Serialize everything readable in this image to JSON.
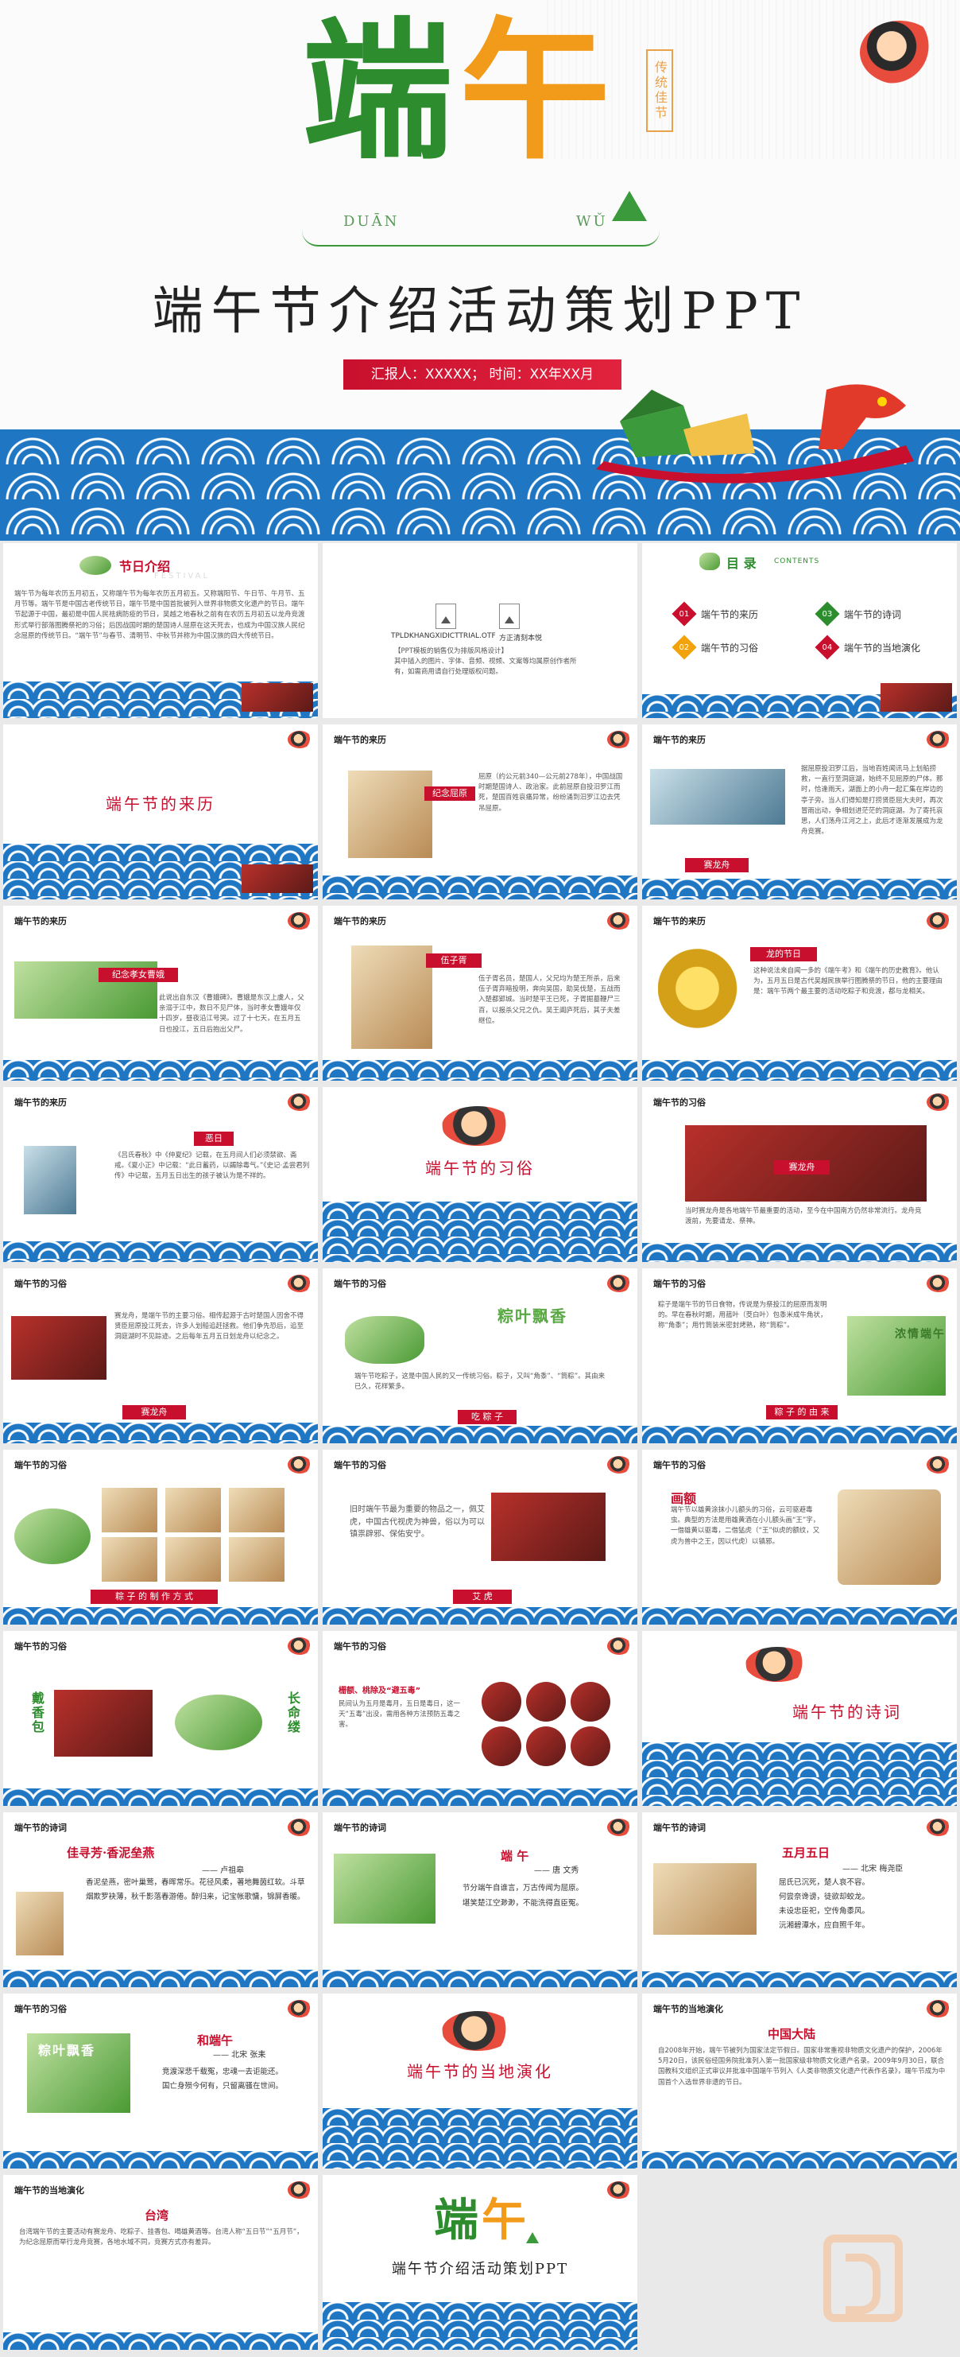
{
  "hero": {
    "title_a": "端",
    "title_b": "午",
    "pinyin_left": "DUĀN",
    "pinyin_right": "WǓ",
    "seal": "传统佳节",
    "subtitle": "端午节介绍活动策划PPT",
    "info": "汇报人：XXXXX； 时间：XX年XX月"
  },
  "slides": {
    "s1": {
      "title": "节日介绍",
      "ghost": "FESTIVAL",
      "body": "端午节为每年农历五月初五，又称端午节为每年农历五月初五。又称端阳节、午日节、午月节、五月节等。端午节是中国古老传统节日，端午节是中国首批被列入世界非物质文化遗产的节日。端午节起源于中国，最初是中国人民祛病防疫的节日，吴越之地春秋之前有在农历五月初五以龙舟竞渡形式举行部落图腾祭祀的习俗；后因战国时期的楚国诗人屈原在这天死去，也成为中国汉族人民纪念屈原的传统节日。“端午节”与春节、清明节、中秋节并称为中国汉族的四大传统节日。"
    },
    "s2": {
      "label1": "TPLDKHANGXIDICTTRIAL.OTF",
      "label2": "方正清刻本悦",
      "body": "【PPT模板的销售仅为排版风格设计】\n其中插入的图片、字体、音频、视频、文案等均属原创作者所有，如需商用请自行处理版权问题。"
    },
    "s3": {
      "title": "目 录",
      "sub": "CONTENTS",
      "items": [
        {
          "num": "01",
          "text": "端午节的来历",
          "color": "#c8102e"
        },
        {
          "num": "02",
          "text": "端午节的习俗",
          "color": "#f2a20b"
        },
        {
          "num": "03",
          "text": "端午节的诗词",
          "color": "#2d8c2d"
        },
        {
          "num": "04",
          "text": "端午节的当地演化",
          "color": "#c8102e"
        }
      ]
    },
    "s4": {
      "title": "端午节的来历"
    },
    "s5": {
      "head": "端午节的来历",
      "bar": "纪念屈原",
      "body": "屈原（约公元前340—公元前278年），中国战国时期楚国诗人、政治家。此前屈原自投汨罗江而死，楚国百姓哀痛异常，纷纷涌到汨罗江边去凭吊屈原。"
    },
    "s6": {
      "head": "端午节的来历",
      "bar": "赛龙舟",
      "body": "据屈原投汨罗江后，当地百姓闻讯马上划船捞救，一直行至洞庭湖，始终不见屈原的尸体。那时，恰逢雨天，湖面上的小舟一起汇集在岸边的亭子旁。当人们得知是打捞贤臣屈大夫时，再次冒雨出动，争相划进茫茫的洞庭湖。为了寄托哀思，人们荡舟江河之上，此后才逐渐发展成为龙舟竞赛。"
    },
    "s7": {
      "head": "端午节的来历",
      "bar": "纪念孝女曹娥",
      "body": "此说出自东汉《曹娥碑》。曹娥是东汉上虞人，父亲溺于江中，数日不见尸体，当时孝女曹娥年仅十四岁，昼夜沿江号哭。过了十七天，在五月五日也投江，五日后抱出父尸。"
    },
    "s8": {
      "head": "端午节的来历",
      "bar": "伍子胥",
      "body": "伍子胥名员，楚国人，父兄均为楚王所杀，后来伍子胥弃暗投明，奔向吴国，助吴伐楚，五战而入楚都郢城。当时楚平王已死，子胥掘墓鞭尸三百，以报杀父兄之仇。吴王阖庐死后，其子夫差继位。"
    },
    "s9": {
      "head": "端午节的来历",
      "bar": "龙的节日",
      "body": "这种说法来自闻一多的《端午考》和《端午的历史教育》。他认为，五月五日是古代吴越民族举行图腾祭的节日，他的主要理由是：端午节两个最主要的活动吃粽子和竞渡，都与龙相关。"
    },
    "s10": {
      "head": "端午节的来历",
      "bar": "恶日",
      "body": "《吕氏春秋》中《仲夏纪》记载，在五月间人们必须禁欲、斋戒。《夏小正》中记载：“此日蓄药，以蠲除毒气。”《史记·孟尝君列传》中记载，五月五日出生的孩子被认为是不祥的。"
    },
    "s11": {
      "title": "端午节的习俗"
    },
    "s12": {
      "head": "端午节的习俗",
      "bar": "赛龙舟",
      "body": "当时赛龙舟是各地端午节最重要的活动，至今在中国南方仍然非常流行。龙舟竞渡前，先要请龙、祭神。"
    },
    "s13": {
      "head": "端午节的习俗",
      "bar": "赛龙舟",
      "body": "赛龙舟，是端午节的主要习俗。相传起源于古时楚国人因舍不得贤臣屈原投江死去，许多人划船追赶拯救。他们争先恐后，追至洞庭湖时不见踪迹。之后每年五月五日划龙舟以纪念之。"
    },
    "s14": {
      "head": "端午节的习俗",
      "calli": "粽叶飘香",
      "bar": "吃 粽 子",
      "body": "端午节吃粽子，这是中国人民的又一传统习俗。粽子，又叫“角黍”、“筒粽”。其由来已久，花样繁多。"
    },
    "s15": {
      "head": "端午节的习俗",
      "calli": "浓情端午",
      "bar": "粽 子 的 由 来",
      "body": "粽子是端午节的节日食物，传说是为祭投江的屈原而发明的。早在春秋时期，用菰叶（茭白叶）包黍米成牛角状，称“角黍”；用竹筒装米密封烤熟，称“筒粽”。"
    },
    "s16": {
      "head": "端午节的习俗",
      "bar": "粽 子 的 制 作 方 式"
    },
    "s17": {
      "head": "端午节的习俗",
      "bar": "艾 虎",
      "body": "旧时端午节最为重要的物品之一，佩艾虎，中国古代视虎为神兽，俗以为可以镇祟辟邪、保佑安宁。"
    },
    "s18": {
      "head": "端午节的习俗",
      "title": "画额",
      "body": "端午节以雄黄涂抹小儿额头的习俗，云可驱避毒虫。典型的方法是用雄黄酒在小儿额头画“王”字，一借雄黄以驱毒，二借猛虎（“王”似虎的额纹，又虎为兽中之王，因以代虎）以镇邪。"
    },
    "s19": {
      "head": "端午节的习俗",
      "left": "戴香包",
      "right": "长命缕"
    },
    "s20": {
      "head": "端午节的习俗",
      "title": "栅额、桃除及“避五毒”",
      "body": "民间认为五月是毒月，五日是毒日，这一天“五毒”出没，需用各种方法预防五毒之害。"
    },
    "s21": {
      "title": "端午节的诗词"
    },
    "s22": {
      "head": "端午节的诗词",
      "title": "佳寻芳·香泥垒燕",
      "author": "—— 卢祖皋",
      "poem": "香泥垒燕，密叶巢莺，春晖常乐。花径风柔，著地舞茵红软。斗草烟欺罗袂薄，秋千影落春游倦。醉归来，记宝帐歌慵，锦屏香暖。"
    },
    "s23": {
      "head": "端午节的诗词",
      "title": "端 午",
      "author": "—— 唐 文秀",
      "poem": "节分端午自谁言，万古传闻为屈原。\n堪笑楚江空渺渺，不能洗得直臣冤。"
    },
    "s24": {
      "head": "端午节的诗词",
      "title": "五月五日",
      "author": "—— 北宋 梅尧臣",
      "poem": "屈氏已沉死，楚人哀不容。\n何尝奈谗谤，徒欲却蛟龙。\n未设忠臣祀，空传角黍风。\n沅湘碧潭水，应自照千年。"
    },
    "s25": {
      "head": "端午节的习俗",
      "calli": "粽叶飘香",
      "title": "和端午",
      "author": "—— 北宋 张耒",
      "poem": "竞渡深悲千载冤，忠魂一去讵能还。\n国亡身殒今何有，只留离骚在世间。"
    },
    "s26": {
      "title": "端午节的当地演化"
    },
    "s27": {
      "head": "端午节的当地演化",
      "title": "中国大陆",
      "body": "自2008年开始，端午节被列为国家法定节假日。国家非常重视非物质文化遗产的保护，2006年5月20日，该民俗经国务院批准列入第一批国家级非物质文化遗产名录。2009年9月30日，联合国教科文组织正式审议并批准中国端午节列入《人类非物质文化遗产代表作名录》，端午节成为中国首个入选世界非遗的节日。"
    },
    "s28": {
      "head": "端午节的当地演化",
      "title": "台湾",
      "body": "台湾端午节的主要活动有赛龙舟、吃粽子、挂香包、喝雄黄酒等。台湾人称“五日节”“五月节”，为纪念屈原而举行龙舟竞赛，各地水域不同，竞赛方式亦有差异。"
    },
    "s29": {
      "title_a": "端",
      "title_b": "午",
      "subtitle": "端午节介绍活动策划PPT"
    }
  }
}
